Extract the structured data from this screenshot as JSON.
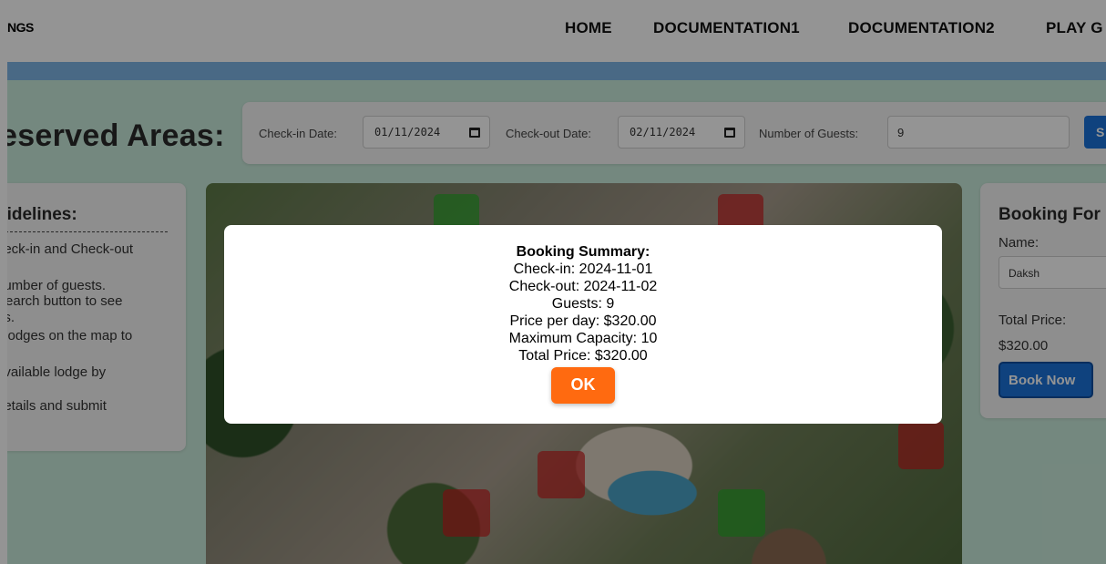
{
  "header": {
    "brand": "NGS",
    "nav": [
      "HOME",
      "DOCUMENTATION1",
      "DOCUMENTATION2",
      "PLAY G"
    ]
  },
  "search": {
    "section_title": "eserved Areas:",
    "checkin_label": "Check-in Date:",
    "checkin_value": "01/11/2024",
    "checkout_label": "Check-out Date:",
    "checkout_value": "02/11/2024",
    "guests_label": "Number of Guests:",
    "guests_value": "9",
    "search_button": "S",
    "calendar_icon": "calendar-icon"
  },
  "guidelines": {
    "title": "uidelines:",
    "lines": [
      "heck-in and Check-out",
      "number of guests.",
      "Search button to see",
      "es.",
      "r lodges on the map to",
      "available lodge by",
      "details and submit",
      "."
    ]
  },
  "map": {
    "lodges": [
      {
        "status": "available"
      },
      {
        "status": "booked"
      },
      {
        "status": "booked"
      },
      {
        "status": "booked"
      },
      {
        "status": "booked"
      },
      {
        "status": "available"
      }
    ]
  },
  "booking_form": {
    "title": "Booking For",
    "name_label": "Name:",
    "name_value": "Daksh",
    "total_label": "Total Price:",
    "total_value": "$320.00",
    "book_button": "Book Now"
  },
  "modal": {
    "title": "Booking Summary:",
    "lines": [
      "Check-in: 2024-11-01",
      "Check-out: 2024-11-02",
      "Guests: 9",
      "Price per day: $320.00",
      "Maximum Capacity: 10",
      "Total Price: $320.00"
    ],
    "ok_button": "OK"
  },
  "colors": {
    "accent_blue": "#1a73d9",
    "ok_orange": "#ff6a10",
    "available": "#28aa28",
    "booked": "#c81e1e"
  }
}
